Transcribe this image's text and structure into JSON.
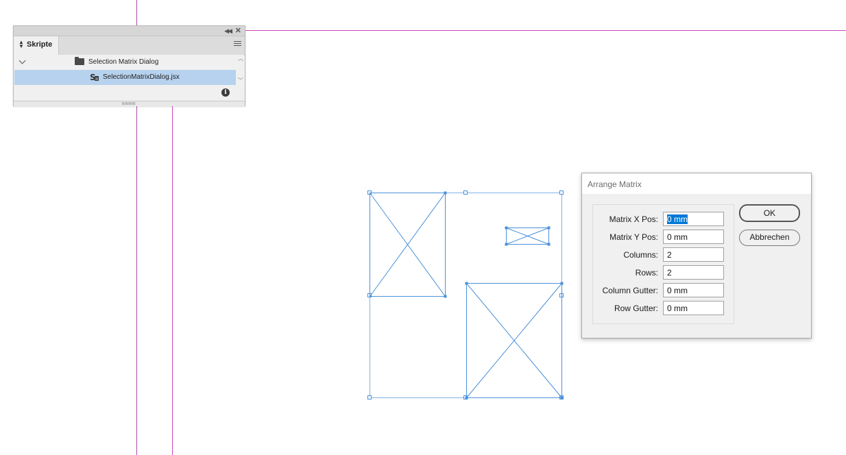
{
  "colors": {
    "guide_purple": "#a64ba8",
    "guide_margin": "#cc44bb",
    "frame_blue": "#4a90d9",
    "selection_highlight": "#b7d2ee"
  },
  "scripts_panel": {
    "collapse_icon": "double-chevron-left-icon",
    "close_icon": "close-icon",
    "tab_label": "Skripte",
    "menu_icon": "hamburger-menu-icon",
    "folder": {
      "label": "Selection Matrix Dialog",
      "expanded": true
    },
    "script_item": {
      "label": "SelectionMatrixDialog.jsx",
      "selected": true
    },
    "info_icon": "info-icon"
  },
  "dialog": {
    "title": "Arrange Matrix",
    "fields": [
      {
        "label": "Matrix X Pos:",
        "value": "0 mm",
        "selected": true
      },
      {
        "label": "Matrix Y Pos:",
        "value": "0 mm"
      },
      {
        "label": "Columns:",
        "value": "2"
      },
      {
        "label": "Rows:",
        "value": "2"
      },
      {
        "label": "Column Gutter:",
        "value": "0 mm"
      },
      {
        "label": "Row Gutter:",
        "value": "0 mm"
      }
    ],
    "ok_label": "OK",
    "cancel_label": "Abbrechen"
  }
}
